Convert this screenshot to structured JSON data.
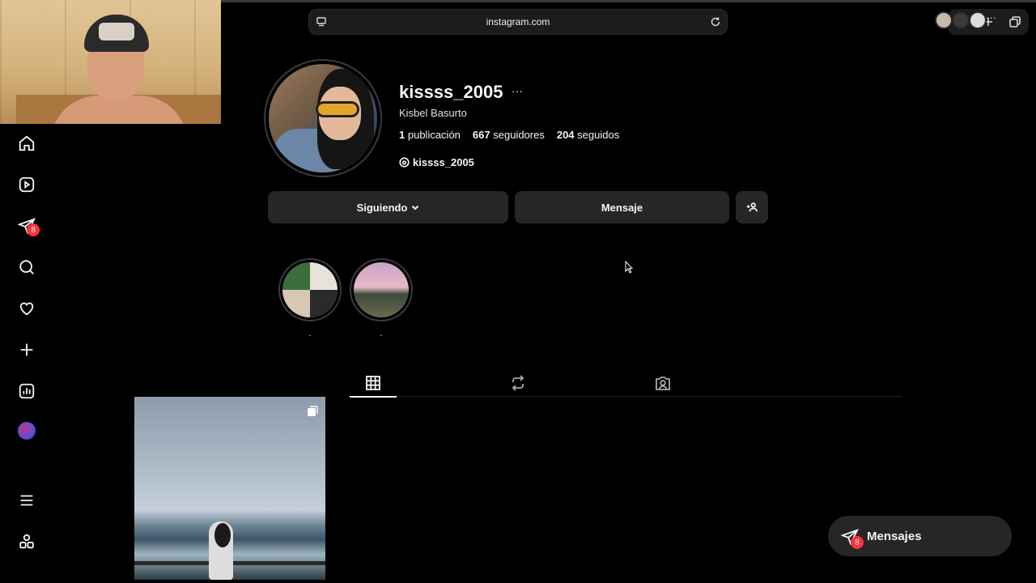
{
  "browser": {
    "url": "instagram.com"
  },
  "profile": {
    "username": "kissss_2005",
    "more": "···",
    "full_name": "Kisbel Basurto",
    "stats": {
      "posts_count": "1",
      "posts_label": "publicación",
      "followers_count": "667",
      "followers_label": "seguidores",
      "following_count": "204",
      "following_label": "seguidos"
    },
    "threads_handle": "kissss_2005"
  },
  "actions": {
    "following_label": "Siguiendo",
    "message_label": "Mensaje"
  },
  "highlights": [
    {
      "label": "."
    },
    {
      "label": "."
    }
  ],
  "sidebar": {
    "items": [
      {
        "icon": "home-icon"
      },
      {
        "icon": "reels-icon"
      },
      {
        "icon": "direct-icon",
        "badge": "8"
      },
      {
        "icon": "search-icon"
      },
      {
        "icon": "heart-icon"
      },
      {
        "icon": "plus-icon"
      },
      {
        "icon": "dashboard-icon"
      },
      {
        "icon": "meta-ai-icon"
      },
      {
        "icon": "menu-icon"
      },
      {
        "icon": "apps-icon"
      }
    ]
  },
  "messages": {
    "label": "Mensajes",
    "badge": "8",
    "more": "···"
  },
  "colors": {
    "background": "#000000",
    "button": "#262626",
    "badge": "#ff3040",
    "text": "#f5f5f5"
  }
}
